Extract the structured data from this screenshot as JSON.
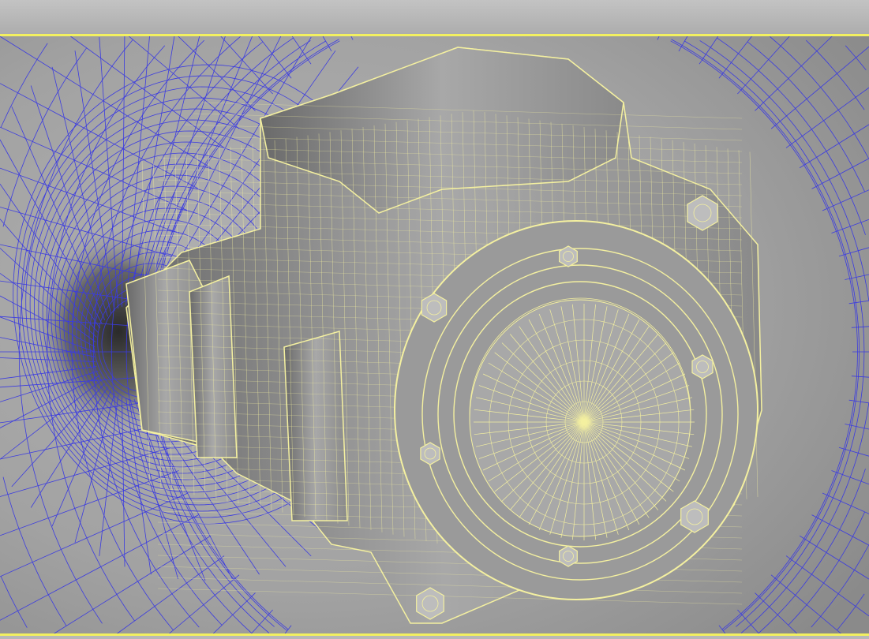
{
  "viewport": {
    "active_border_color": "#f2f060",
    "background_color": "#a4a4a4",
    "environment_wire_color": "#3b3be0",
    "object_wire_color": "#f4f0a0",
    "object_shade_color": "#8c8c8c"
  }
}
